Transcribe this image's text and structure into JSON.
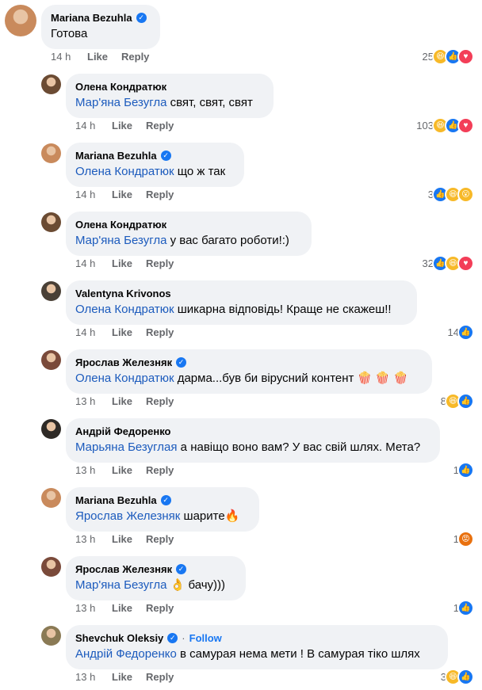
{
  "comments": [
    {
      "author": "Mariana Bezuhla",
      "verified": true,
      "mention": "",
      "text": "Готова",
      "time": "14 h",
      "like": "Like",
      "reply": "Reply",
      "reaction_count": "25",
      "reactions": [
        "haha",
        "like",
        "love"
      ],
      "avatar_color": "#c98a5c"
    },
    {
      "author": "Олена Кондратюк",
      "verified": false,
      "mention": "Мар'яна Безугла",
      "text": " свят, свят, свят",
      "time": "14 h",
      "like": "Like",
      "reply": "Reply",
      "reaction_count": "103",
      "reactions": [
        "haha",
        "like",
        "love"
      ],
      "avatar_color": "#6b4b33"
    },
    {
      "author": "Mariana Bezuhla",
      "verified": true,
      "mention": "Олена Кондратюк",
      "text": " що ж так",
      "time": "14 h",
      "like": "Like",
      "reply": "Reply",
      "reaction_count": "3",
      "reactions": [
        "like",
        "haha",
        "wow"
      ],
      "avatar_color": "#c98a5c"
    },
    {
      "author": "Олена Кондратюк",
      "verified": false,
      "mention": "Мар'яна Безугла",
      "text": " у вас багато роботи!:)",
      "time": "14 h",
      "like": "Like",
      "reply": "Reply",
      "reaction_count": "32",
      "reactions": [
        "like",
        "haha",
        "love"
      ],
      "avatar_color": "#6b4b33"
    },
    {
      "author": "Valentyna Krivonos",
      "verified": false,
      "mention": "Олена Кондратюк",
      "text": " шикарна відповідь! Краще не скажеш!!",
      "time": "14 h",
      "like": "Like",
      "reply": "Reply",
      "reaction_count": "14",
      "reactions": [
        "like"
      ],
      "avatar_color": "#4a4036"
    },
    {
      "author": "Ярослав Железняк",
      "verified": true,
      "mention": "Олена Кондратюк",
      "text": " дарма...був би вірусний контент 🍿 🍿 🍿",
      "time": "13 h",
      "like": "Like",
      "reply": "Reply",
      "reaction_count": "8",
      "reactions": [
        "haha",
        "like"
      ],
      "avatar_color": "#7a4a3a"
    },
    {
      "author": "Андрій Федоренко",
      "verified": false,
      "mention": "Марьяна Безуглая",
      "text": " а навіщо воно вам? У вас свій шлях. Мета?",
      "time": "13 h",
      "like": "Like",
      "reply": "Reply",
      "reaction_count": "1",
      "reactions": [
        "like"
      ],
      "avatar_color": "#2e2a26"
    },
    {
      "author": "Mariana Bezuhla",
      "verified": true,
      "mention": "Ярослав Железняк",
      "text": " шарите🔥",
      "time": "13 h",
      "like": "Like",
      "reply": "Reply",
      "reaction_count": "1",
      "reactions": [
        "angry"
      ],
      "avatar_color": "#c98a5c"
    },
    {
      "author": "Ярослав Железняк",
      "verified": true,
      "mention": "Мар'яна Безугла",
      "text": " 👌 бачу)))",
      "time": "13 h",
      "like": "Like",
      "reply": "Reply",
      "reaction_count": "1",
      "reactions": [
        "like"
      ],
      "avatar_color": "#7a4a3a"
    },
    {
      "author": "Shevchuk Oleksiy",
      "verified": true,
      "follow": "Follow",
      "mention": "Андрій Федоренко",
      "text": " в самурая нема мети ! В самурая тіко шлях",
      "time": "13 h",
      "like": "Like",
      "reply": "Reply",
      "reaction_count": "3",
      "reactions": [
        "haha",
        "like"
      ],
      "avatar_color": "#8a7a55"
    }
  ],
  "colors": {
    "mention": "#1c5bbd",
    "like_blue": "#1877f2",
    "love_red": "#f33e58",
    "bubble": "#f0f2f5"
  }
}
